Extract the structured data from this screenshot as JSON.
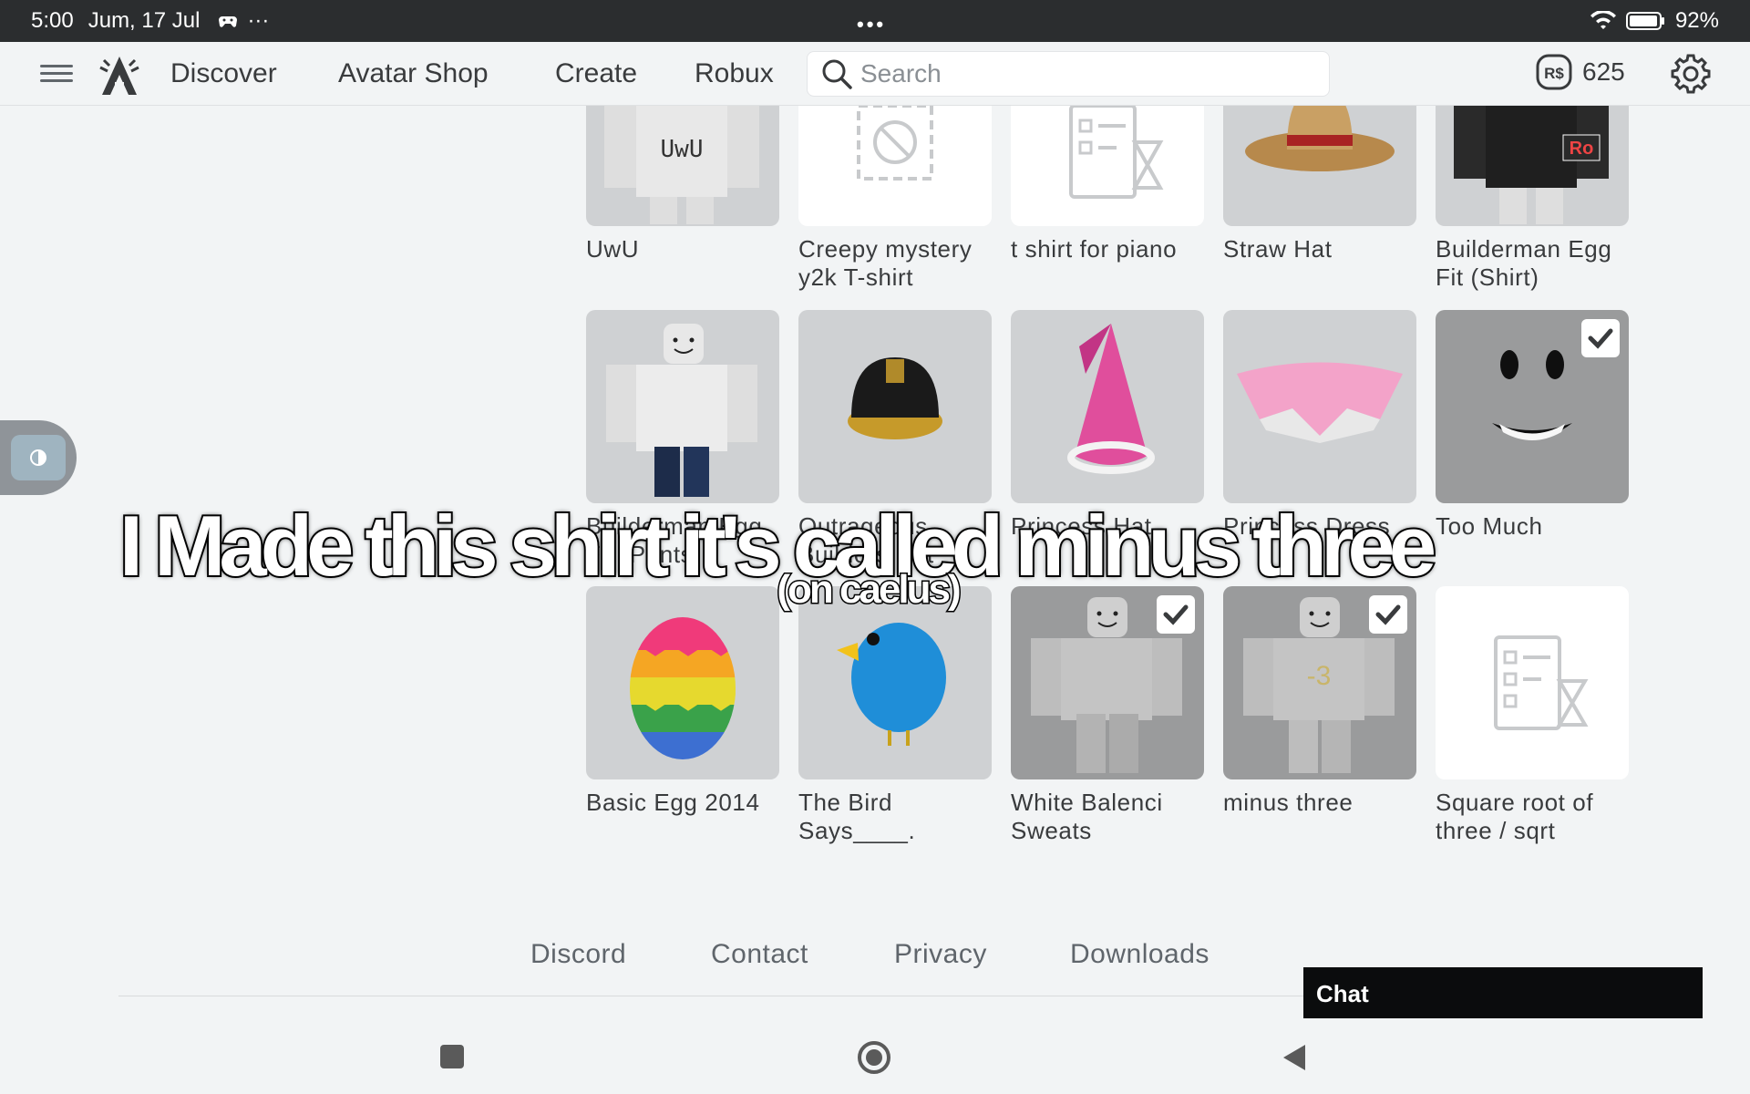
{
  "status_bar": {
    "time": "5:00",
    "date": "Jum, 17 Jul",
    "more": "···",
    "center_dots": "•••",
    "battery": "92%"
  },
  "nav": {
    "links": [
      "Discover",
      "Avatar Shop",
      "Create",
      "Robux"
    ],
    "search_placeholder": "Search",
    "robux_amount": "625",
    "robux_symbol": "R$"
  },
  "items": [
    {
      "name": "UwU",
      "thumb": "shirt-uwu",
      "bg": "gray",
      "checked": false,
      "shirt_text": "UwU"
    },
    {
      "name": "Creepy mystery y2k T-shirt",
      "thumb": "blocked-icon",
      "bg": "white",
      "checked": false
    },
    {
      "name": "t shirt for piano",
      "thumb": "pending-icon",
      "bg": "white",
      "checked": false
    },
    {
      "name": "Straw Hat",
      "thumb": "straw-hat",
      "bg": "gray",
      "checked": false
    },
    {
      "name": "Builderman Egg Fit (Shirt)",
      "thumb": "shirt-black",
      "bg": "gray",
      "checked": false,
      "shirt_text": "Ro"
    },
    {
      "name": "Builderman Egg Fit (Pants)",
      "thumb": "avatar-pants",
      "bg": "gray",
      "checked": false
    },
    {
      "name": "Outrageous Builders Hat",
      "thumb": "builder-helmet",
      "bg": "gray",
      "checked": false
    },
    {
      "name": "Princess Hat",
      "thumb": "princess-hat",
      "bg": "gray",
      "checked": false
    },
    {
      "name": "Princess Dress",
      "thumb": "pink-skirt",
      "bg": "gray",
      "checked": false
    },
    {
      "name": "Too Much",
      "thumb": "face-grin",
      "bg": "dark",
      "checked": true
    },
    {
      "name": "Basic Egg 2014",
      "thumb": "easter-egg",
      "bg": "gray",
      "checked": false
    },
    {
      "name": "The Bird Says____.",
      "thumb": "blue-bird",
      "bg": "gray",
      "checked": false
    },
    {
      "name": "White Balenci Sweats",
      "thumb": "avatar-sweats",
      "bg": "dark",
      "checked": true
    },
    {
      "name": "minus three",
      "thumb": "avatar-minus-three",
      "bg": "dark",
      "checked": true,
      "shirt_text": "-3"
    },
    {
      "name": "Square root of three / sqrt",
      "thumb": "pending-icon",
      "bg": "white",
      "checked": false
    }
  ],
  "caption": {
    "main": "I Made this shirt it's called minus three",
    "sub": "(on caelus)"
  },
  "footer": {
    "links": [
      "Discord",
      "Contact",
      "Privacy",
      "Downloads"
    ],
    "chat_label": "Chat"
  },
  "colors": {
    "accent": "#0b0c0d",
    "page_bg": "#f2f4f5",
    "card_gray": "#cfd1d3",
    "card_dark": "#9a9b9c"
  }
}
